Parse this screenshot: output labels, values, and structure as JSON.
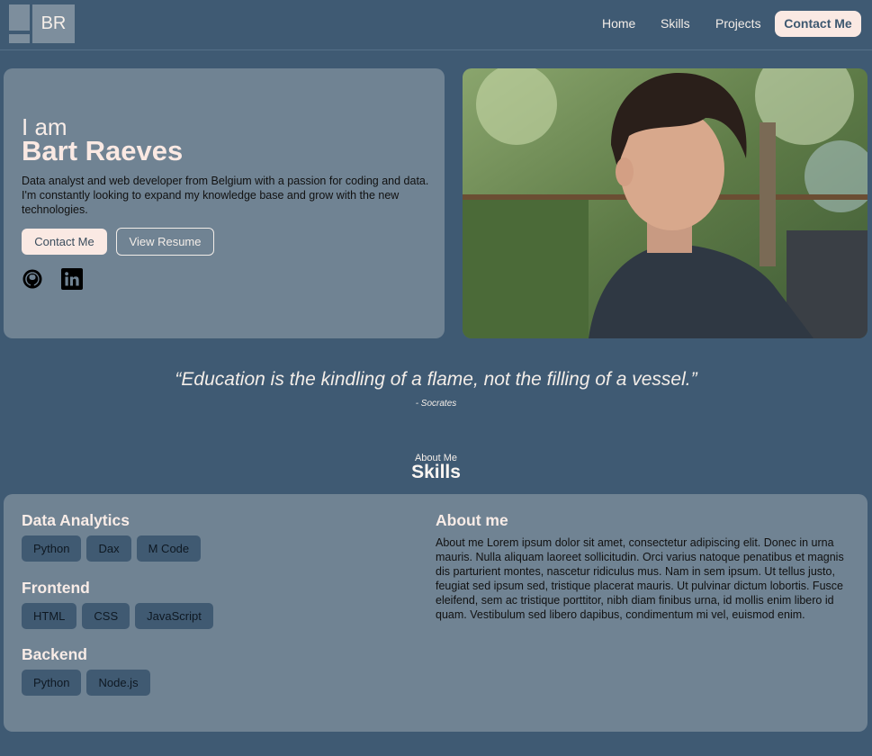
{
  "nav": {
    "logo_text": "BR",
    "links": [
      "Home",
      "Skills",
      "Projects"
    ],
    "cta_label": "Contact Me"
  },
  "hero": {
    "intro": "I am",
    "name": "Bart Raeves",
    "description": "Data analyst and web developer from Belgium with a passion for coding and data. I'm constantly looking to expand my knowledge base and grow with the new technologies.",
    "contact_label": "Contact Me",
    "resume_label": "View Resume",
    "socials": [
      "github-icon",
      "linkedin-icon"
    ]
  },
  "quote": {
    "text": "“Education is the kindling of a flame, not the filling of a vessel.”",
    "author": "- Socrates"
  },
  "skills_section": {
    "subtitle": "About Me",
    "title": "Skills",
    "groups": [
      {
        "title": "Data Analytics",
        "items": [
          "Python",
          "Dax",
          "M Code"
        ]
      },
      {
        "title": "Frontend",
        "items": [
          "HTML",
          "CSS",
          "JavaScript"
        ]
      },
      {
        "title": "Backend",
        "items": [
          "Python",
          "Node.js"
        ]
      }
    ],
    "about_title": "About me",
    "about_text": "About me Lorem ipsum dolor sit amet, consectetur adipiscing elit. Donec in urna mauris. Nulla aliquam laoreet sollicitudin. Orci varius natoque penatibus et magnis dis parturient montes, nascetur ridiculus mus. Nam in sem ipsum. Ut tellus justo, feugiat sed ipsum sed, tristique placerat mauris. Ut pulvinar dictum lobortis. Fusce eleifend, sem ac tristique porttitor, nibh diam finibus urna, id mollis enim libero id quam. Vestibulum sed libero dapibus, condimentum mi vel, euismod enim."
  },
  "colors": {
    "background": "#3f5a73",
    "card": "#708393",
    "accent": "#fae9e3",
    "pill": "#405a72"
  }
}
